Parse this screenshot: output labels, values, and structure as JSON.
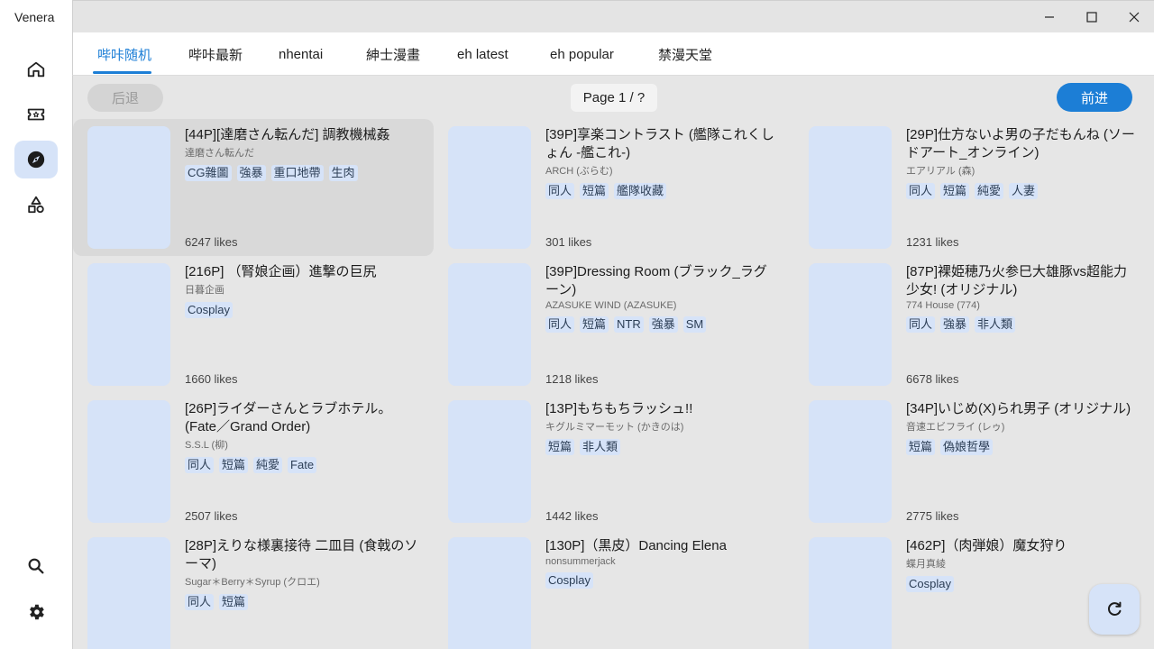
{
  "app": {
    "title": "Venera"
  },
  "nav": {
    "items": [
      {
        "icon": "home-icon",
        "active": false
      },
      {
        "icon": "ticket-icon",
        "active": false
      },
      {
        "icon": "explore-icon",
        "active": true
      },
      {
        "icon": "categories-icon",
        "active": false
      }
    ],
    "bottom": [
      {
        "icon": "search-icon"
      },
      {
        "icon": "gear-icon"
      }
    ]
  },
  "tabs": [
    {
      "label": "哔咔随机",
      "active": true
    },
    {
      "label": "哔咔最新",
      "active": false
    },
    {
      "label": "nhentai",
      "active": false
    },
    {
      "label": "紳士漫畫",
      "active": false
    },
    {
      "label": "eh latest",
      "active": false
    },
    {
      "label": "eh popular",
      "active": false
    },
    {
      "label": "禁漫天堂",
      "active": false
    }
  ],
  "pager": {
    "back_label": "后退",
    "page_label": "Page 1 / ?",
    "next_label": "前进"
  },
  "colors": {
    "accent": "#1c7ed6",
    "tag_bg": "#d6e3f8",
    "content_bg": "#e6e6e6"
  },
  "cards": [
    {
      "title": "[44P][達磨さん転んだ] 調教機械姦",
      "subtitle": "達磨さん転んだ",
      "tags": [
        "CG雜圖",
        "強暴",
        "重口地帶",
        "生肉"
      ],
      "likes": "6247 likes"
    },
    {
      "title": "[39P]享楽コントラスト (艦隊これくしょん -艦これ-)",
      "subtitle": "ARCH (ぶらむ)",
      "tags": [
        "同人",
        "短篇",
        "艦隊收藏"
      ],
      "likes": "301 likes"
    },
    {
      "title": "[29P]仕方ないよ男の子だもんね (ソードアート_オンライン)",
      "subtitle": "エアリアル (森)",
      "tags": [
        "同人",
        "短篇",
        "純愛",
        "人妻"
      ],
      "likes": "1231 likes"
    },
    {
      "title": "[216P] （腎娘企画）進撃の巨尻",
      "subtitle": "日暮企画",
      "tags": [
        "Cosplay"
      ],
      "likes": "1660 likes"
    },
    {
      "title": "[39P]Dressing Room (ブラック_ラグーン)",
      "subtitle": "AZASUKE WIND (AZASUKE)",
      "tags": [
        "同人",
        "短篇",
        "NTR",
        "強暴",
        "SM"
      ],
      "likes": "1218 likes"
    },
    {
      "title": "[87P]裸姫穂乃火参巳大雄豚vs超能力少女! (オリジナル)",
      "subtitle": "774 House (774)",
      "tags": [
        "同人",
        "強暴",
        "非人類"
      ],
      "likes": "6678 likes"
    },
    {
      "title": "[26P]ライダーさんとラブホテル。(Fate／Grand Order)",
      "subtitle": "S.S.L (柳)",
      "tags": [
        "同人",
        "短篇",
        "純愛",
        "Fate"
      ],
      "likes": "2507 likes"
    },
    {
      "title": "[13P]もちもちラッシュ!!",
      "subtitle": "キグルミマーモット (かきのは)",
      "tags": [
        "短篇",
        "非人類"
      ],
      "likes": "1442 likes"
    },
    {
      "title": "[34P]いじめ(X)られ男子 (オリジナル)",
      "subtitle": "音速エビフライ (レゥ)",
      "tags": [
        "短篇",
        "偽娘哲學"
      ],
      "likes": "2775 likes"
    },
    {
      "title": "[28P]えりな様裏接待 二皿目 (食戟のソーマ)",
      "subtitle": "Sugar＊Berry＊Syrup (クロエ)",
      "tags": [
        "同人",
        "短篇"
      ],
      "likes": ""
    },
    {
      "title": "[130P]（黒皮）Dancing Elena",
      "subtitle": "nonsummerjack",
      "tags": [
        "Cosplay"
      ],
      "likes": ""
    },
    {
      "title": "[462P]（肉弾娘）魔女狩り",
      "subtitle": "蝶月真綾",
      "tags": [
        "Cosplay"
      ],
      "likes": ""
    }
  ]
}
